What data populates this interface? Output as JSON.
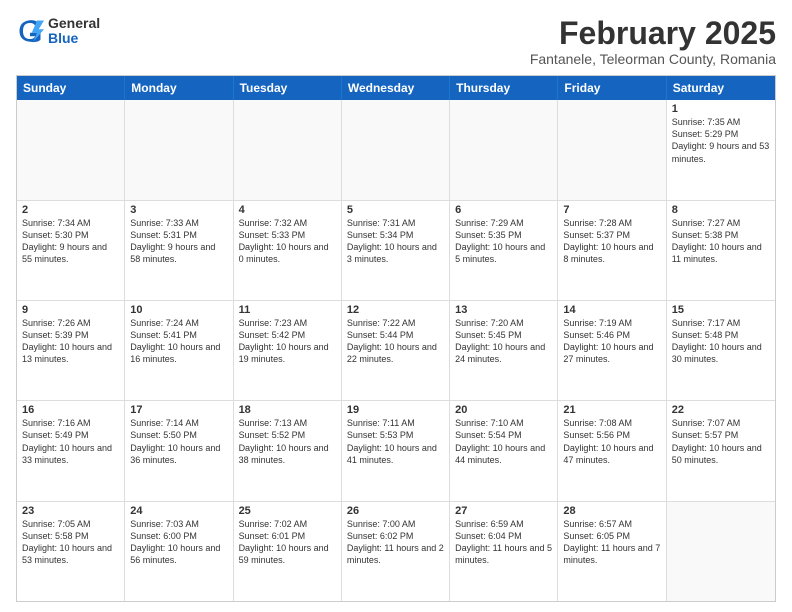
{
  "logo": {
    "general": "General",
    "blue": "Blue"
  },
  "title": "February 2025",
  "subtitle": "Fantanele, Teleorman County, Romania",
  "header_days": [
    "Sunday",
    "Monday",
    "Tuesday",
    "Wednesday",
    "Thursday",
    "Friday",
    "Saturday"
  ],
  "weeks": [
    [
      {
        "day": "",
        "info": ""
      },
      {
        "day": "",
        "info": ""
      },
      {
        "day": "",
        "info": ""
      },
      {
        "day": "",
        "info": ""
      },
      {
        "day": "",
        "info": ""
      },
      {
        "day": "",
        "info": ""
      },
      {
        "day": "1",
        "info": "Sunrise: 7:35 AM\nSunset: 5:29 PM\nDaylight: 9 hours and 53 minutes."
      }
    ],
    [
      {
        "day": "2",
        "info": "Sunrise: 7:34 AM\nSunset: 5:30 PM\nDaylight: 9 hours and 55 minutes."
      },
      {
        "day": "3",
        "info": "Sunrise: 7:33 AM\nSunset: 5:31 PM\nDaylight: 9 hours and 58 minutes."
      },
      {
        "day": "4",
        "info": "Sunrise: 7:32 AM\nSunset: 5:33 PM\nDaylight: 10 hours and 0 minutes."
      },
      {
        "day": "5",
        "info": "Sunrise: 7:31 AM\nSunset: 5:34 PM\nDaylight: 10 hours and 3 minutes."
      },
      {
        "day": "6",
        "info": "Sunrise: 7:29 AM\nSunset: 5:35 PM\nDaylight: 10 hours and 5 minutes."
      },
      {
        "day": "7",
        "info": "Sunrise: 7:28 AM\nSunset: 5:37 PM\nDaylight: 10 hours and 8 minutes."
      },
      {
        "day": "8",
        "info": "Sunrise: 7:27 AM\nSunset: 5:38 PM\nDaylight: 10 hours and 11 minutes."
      }
    ],
    [
      {
        "day": "9",
        "info": "Sunrise: 7:26 AM\nSunset: 5:39 PM\nDaylight: 10 hours and 13 minutes."
      },
      {
        "day": "10",
        "info": "Sunrise: 7:24 AM\nSunset: 5:41 PM\nDaylight: 10 hours and 16 minutes."
      },
      {
        "day": "11",
        "info": "Sunrise: 7:23 AM\nSunset: 5:42 PM\nDaylight: 10 hours and 19 minutes."
      },
      {
        "day": "12",
        "info": "Sunrise: 7:22 AM\nSunset: 5:44 PM\nDaylight: 10 hours and 22 minutes."
      },
      {
        "day": "13",
        "info": "Sunrise: 7:20 AM\nSunset: 5:45 PM\nDaylight: 10 hours and 24 minutes."
      },
      {
        "day": "14",
        "info": "Sunrise: 7:19 AM\nSunset: 5:46 PM\nDaylight: 10 hours and 27 minutes."
      },
      {
        "day": "15",
        "info": "Sunrise: 7:17 AM\nSunset: 5:48 PM\nDaylight: 10 hours and 30 minutes."
      }
    ],
    [
      {
        "day": "16",
        "info": "Sunrise: 7:16 AM\nSunset: 5:49 PM\nDaylight: 10 hours and 33 minutes."
      },
      {
        "day": "17",
        "info": "Sunrise: 7:14 AM\nSunset: 5:50 PM\nDaylight: 10 hours and 36 minutes."
      },
      {
        "day": "18",
        "info": "Sunrise: 7:13 AM\nSunset: 5:52 PM\nDaylight: 10 hours and 38 minutes."
      },
      {
        "day": "19",
        "info": "Sunrise: 7:11 AM\nSunset: 5:53 PM\nDaylight: 10 hours and 41 minutes."
      },
      {
        "day": "20",
        "info": "Sunrise: 7:10 AM\nSunset: 5:54 PM\nDaylight: 10 hours and 44 minutes."
      },
      {
        "day": "21",
        "info": "Sunrise: 7:08 AM\nSunset: 5:56 PM\nDaylight: 10 hours and 47 minutes."
      },
      {
        "day": "22",
        "info": "Sunrise: 7:07 AM\nSunset: 5:57 PM\nDaylight: 10 hours and 50 minutes."
      }
    ],
    [
      {
        "day": "23",
        "info": "Sunrise: 7:05 AM\nSunset: 5:58 PM\nDaylight: 10 hours and 53 minutes."
      },
      {
        "day": "24",
        "info": "Sunrise: 7:03 AM\nSunset: 6:00 PM\nDaylight: 10 hours and 56 minutes."
      },
      {
        "day": "25",
        "info": "Sunrise: 7:02 AM\nSunset: 6:01 PM\nDaylight: 10 hours and 59 minutes."
      },
      {
        "day": "26",
        "info": "Sunrise: 7:00 AM\nSunset: 6:02 PM\nDaylight: 11 hours and 2 minutes."
      },
      {
        "day": "27",
        "info": "Sunrise: 6:59 AM\nSunset: 6:04 PM\nDaylight: 11 hours and 5 minutes."
      },
      {
        "day": "28",
        "info": "Sunrise: 6:57 AM\nSunset: 6:05 PM\nDaylight: 11 hours and 7 minutes."
      },
      {
        "day": "",
        "info": ""
      }
    ]
  ]
}
